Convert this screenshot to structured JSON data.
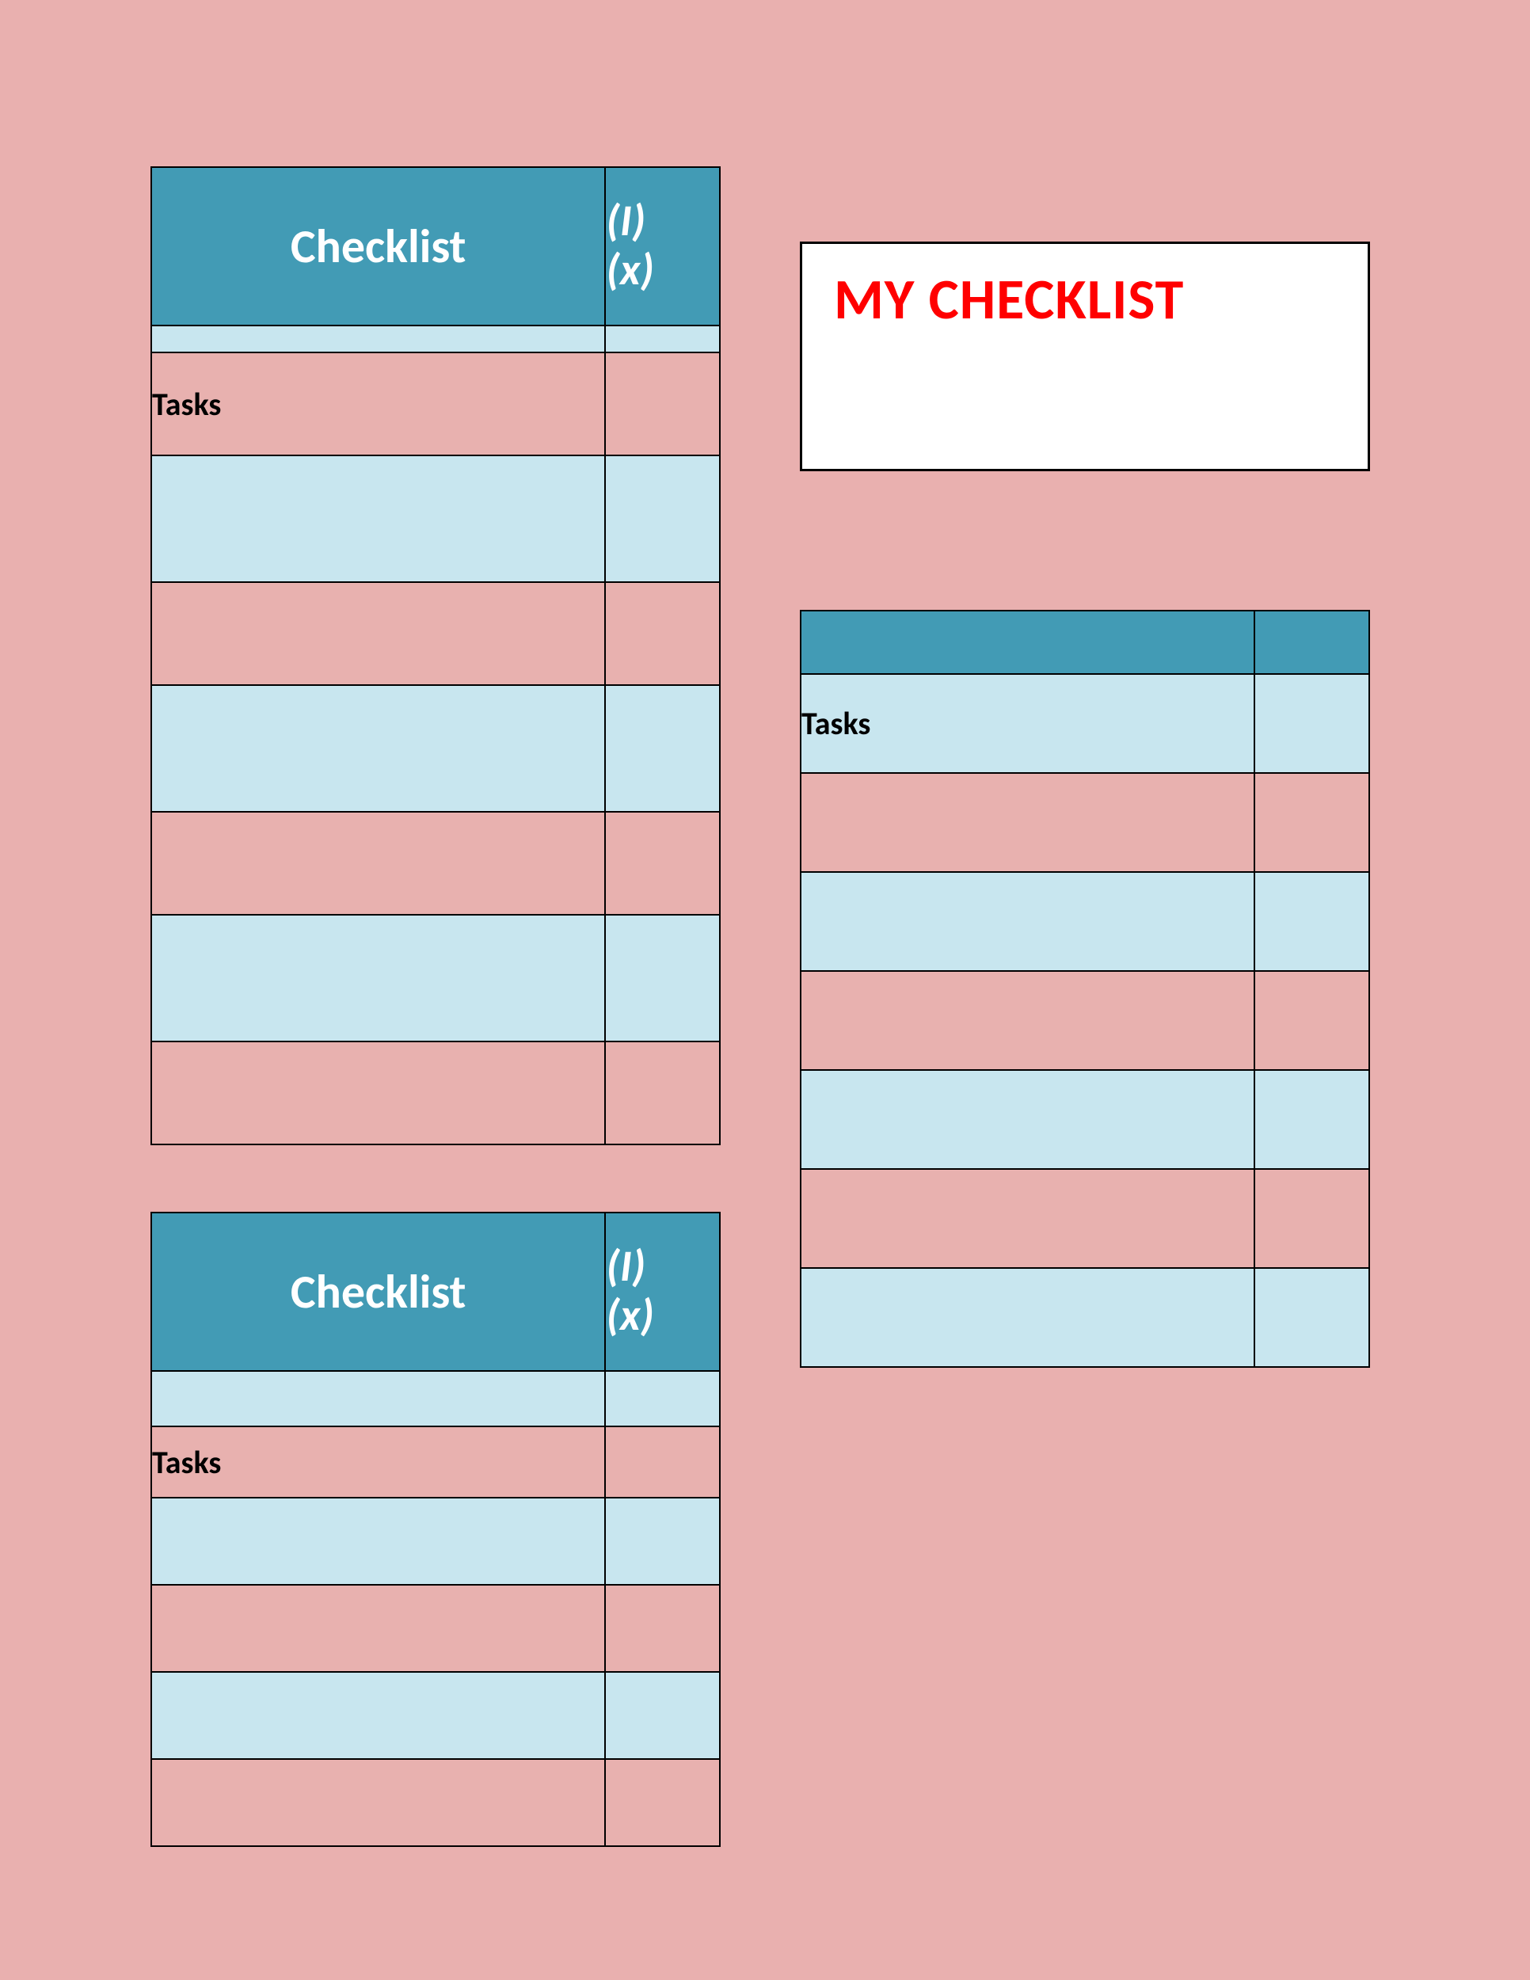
{
  "colors": {
    "page_bg": "#e9b0af",
    "header_bg": "#429bb5",
    "header_fg": "#ffffff",
    "row_odd": "#c8e6ef",
    "row_even": "#e8b1af",
    "title_fg": "#ff0000"
  },
  "title_box": {
    "text": "MY CHECKLIST"
  },
  "table1": {
    "header_title": "Checklist",
    "header_mark_line1": "(I)",
    "header_mark_line2": "(x)",
    "tasks_label": "Tasks",
    "rows": [
      "",
      "",
      "",
      "",
      "",
      "",
      ""
    ]
  },
  "table2": {
    "header_title": "Checklist",
    "header_mark_line1": "(I)",
    "header_mark_line2": "(x)",
    "tasks_label": "Tasks",
    "rows": [
      "",
      "",
      "",
      "",
      ""
    ]
  },
  "table3": {
    "header_title": "",
    "header_mark": "",
    "tasks_label": "Tasks",
    "rows": [
      "",
      "",
      "",
      "",
      "",
      "",
      "",
      ""
    ]
  }
}
